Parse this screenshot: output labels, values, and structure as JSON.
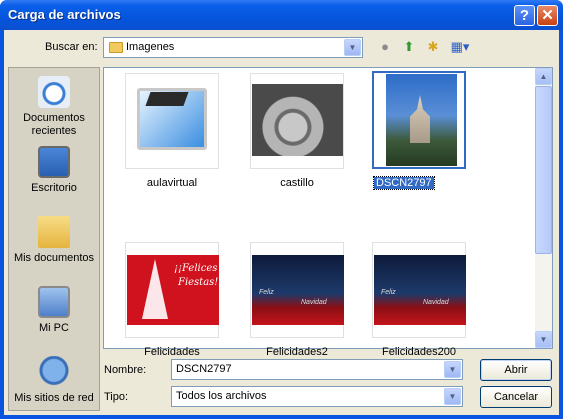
{
  "window": {
    "title": "Carga de archivos"
  },
  "titlebar": {
    "help_label": "?",
    "close_label": "✕"
  },
  "lookin": {
    "label": "Buscar en:",
    "value": "Imagenes"
  },
  "places": [
    {
      "label_line1": "Documentos",
      "label_line2": "recientes",
      "icon": "recent-documents-icon"
    },
    {
      "label_line1": "Escritorio",
      "label_line2": "",
      "icon": "desktop-icon"
    },
    {
      "label_line1": "Mis documentos",
      "label_line2": "",
      "icon": "my-documents-icon"
    },
    {
      "label_line1": "Mi PC",
      "label_line2": "",
      "icon": "my-computer-icon"
    },
    {
      "label_line1": "Mis sitios de red",
      "label_line2": "",
      "icon": "network-places-icon"
    }
  ],
  "files": [
    {
      "name": "aulavirtual",
      "selected": false
    },
    {
      "name": "castillo",
      "selected": false
    },
    {
      "name": "DSCN2797",
      "selected": true
    },
    {
      "name": "Felicidades",
      "selected": false
    },
    {
      "name": "Felicidades2",
      "selected": false
    },
    {
      "name": "Felicidades200",
      "selected": false
    }
  ],
  "thumb_text": {
    "felicidades_line1": "¡¡Felices",
    "felicidades_line2": "Fiestas!!",
    "navidad_line1": "Feliz",
    "navidad_line2": "Navidad"
  },
  "filename": {
    "label": "Nombre:",
    "value": "DSCN2797"
  },
  "filetype": {
    "label": "Tipo:",
    "value": "Todos los archivos"
  },
  "buttons": {
    "open": "Abrir",
    "cancel": "Cancelar"
  },
  "colors": {
    "titlebar": "#0555dc",
    "selection": "#316ac5",
    "dialog": "#ece9d8"
  }
}
